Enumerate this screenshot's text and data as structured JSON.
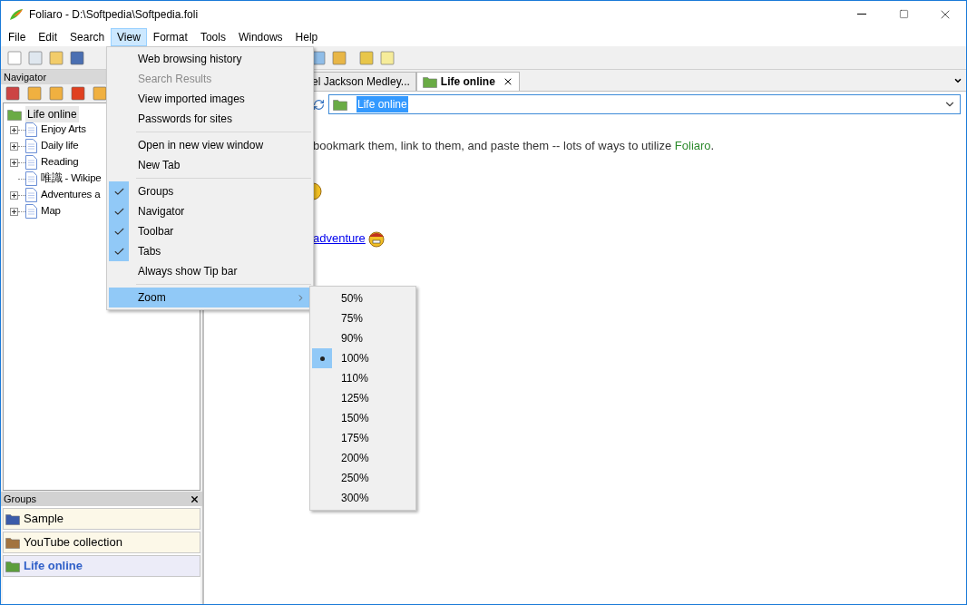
{
  "window": {
    "title": "Foliaro - D:\\Softpedia\\Softpedia.foli"
  },
  "menu_bar": [
    {
      "label": "File",
      "selected": false
    },
    {
      "label": "Edit",
      "selected": false
    },
    {
      "label": "Search",
      "selected": false
    },
    {
      "label": "View",
      "selected": true
    },
    {
      "label": "Format",
      "selected": false
    },
    {
      "label": "Tools",
      "selected": false
    },
    {
      "label": "Windows",
      "selected": false
    },
    {
      "label": "Help",
      "selected": false
    }
  ],
  "navigator": {
    "title": "Navigator",
    "tree": [
      {
        "label": "Life online",
        "selected": true,
        "children": [
          {
            "label": "Enjoy Arts",
            "expandable": true
          },
          {
            "label": "Daily life",
            "expandable": true
          },
          {
            "label": "Reading",
            "expandable": true
          },
          {
            "label": "唯識 - Wikipe",
            "expandable": false
          },
          {
            "label": "Adventures a",
            "expandable": true
          },
          {
            "label": "Map",
            "expandable": true
          }
        ]
      }
    ]
  },
  "groups": {
    "title": "Groups",
    "items": [
      {
        "label": "Sample",
        "color": "#3b5ba9",
        "selected": false
      },
      {
        "label": "YouTube collection",
        "color": "#a2743f",
        "selected": false
      },
      {
        "label": "Life online",
        "color": "#5c9e3c",
        "selected": true
      }
    ]
  },
  "tabs": [
    {
      "label": "el Jackson Medley...",
      "selected": false
    },
    {
      "label": "Life online",
      "selected": true
    }
  ],
  "address": {
    "value": "Life online"
  },
  "content": {
    "text_before": "bookmark them, link to them, and paste them -- lots of ways to utilize ",
    "highlight": "Foliaro",
    "text_after": ".",
    "link": "adventure"
  },
  "view_menu": [
    {
      "kind": "item",
      "label": "Web browsing history",
      "disabled": false,
      "checked": false
    },
    {
      "kind": "item",
      "label": "Search Results",
      "disabled": true,
      "checked": false
    },
    {
      "kind": "item",
      "label": "View imported images",
      "disabled": false,
      "checked": false
    },
    {
      "kind": "item",
      "label": "Passwords for sites",
      "disabled": false,
      "checked": false
    },
    {
      "kind": "separator"
    },
    {
      "kind": "item",
      "label": "Open in new view window",
      "disabled": false,
      "checked": false
    },
    {
      "kind": "item",
      "label": "New Tab",
      "disabled": false,
      "checked": false
    },
    {
      "kind": "separator"
    },
    {
      "kind": "item",
      "label": "Groups",
      "disabled": false,
      "checked": true
    },
    {
      "kind": "item",
      "label": "Navigator",
      "disabled": false,
      "checked": true
    },
    {
      "kind": "item",
      "label": "Toolbar",
      "disabled": false,
      "checked": true
    },
    {
      "kind": "item",
      "label": "Tabs",
      "disabled": false,
      "checked": true
    },
    {
      "kind": "item",
      "label": "Always show Tip bar",
      "disabled": false,
      "checked": false
    },
    {
      "kind": "separator"
    },
    {
      "kind": "submenu",
      "label": "Zoom",
      "disabled": false,
      "checked": false,
      "selected": true
    }
  ],
  "zoom_menu": [
    {
      "label": "50%",
      "selected": false
    },
    {
      "label": "75%",
      "selected": false
    },
    {
      "label": "90%",
      "selected": false
    },
    {
      "label": "100%",
      "selected": true
    },
    {
      "label": "110%",
      "selected": false
    },
    {
      "label": "125%",
      "selected": false
    },
    {
      "label": "150%",
      "selected": false
    },
    {
      "label": "175%",
      "selected": false
    },
    {
      "label": "200%",
      "selected": false
    },
    {
      "label": "250%",
      "selected": false
    },
    {
      "label": "300%",
      "selected": false
    }
  ]
}
